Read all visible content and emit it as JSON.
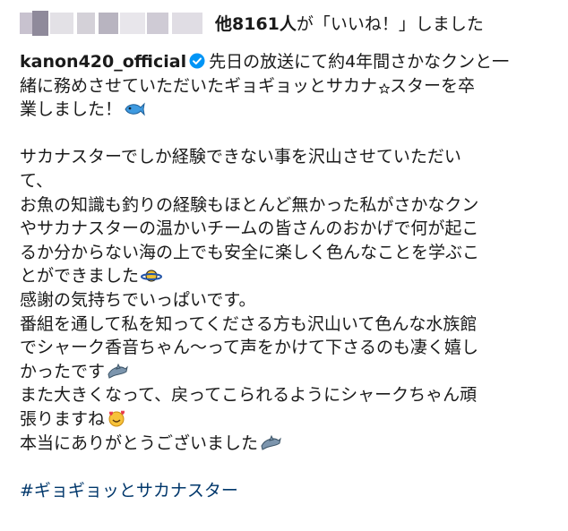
{
  "likes": {
    "count_label": "他8161人",
    "suffix": "が「いいね！」しました"
  },
  "post": {
    "username": "kanon420_official",
    "lines": [
      "先日の放送にて約4年間さかなクンと一",
      "緒に務めさせていただいたギョギョッとサカナ",
      "スターを卒",
      "業しました！",
      "サカナスターでしか経験できない事を沢山させていただい",
      "て、",
      "お魚の知識も釣りの経験もほとんど無かった私がさかなクン",
      "やサカナスターの温かいチームの皆さんのおかげで何が起こ",
      "るか分からない海の上でも安全に楽しく色んなことを学ぶこ",
      "とができました",
      "感謝の気持ちでいっぱいです。",
      "番組を通して私を知ってくださる方も沢山いて色んな水族館",
      "でシャーク香音ちゃん〜って声をかけて下さるのも凄く嬉し",
      "かったです",
      "また大きくなって、戻ってこられるようにシャークちゃん頑",
      "張りますね",
      "本当にありがとうございました"
    ],
    "hashtag": "#ギョギョッとサカナスター"
  },
  "icons": {
    "verified": "verified-badge-icon",
    "star": "star-icon",
    "fish": "fish-emoji-icon",
    "saturn": "ringed-planet-emoji-icon",
    "dolphin": "dolphin-emoji-icon",
    "smile": "smiling-face-with-hearts-emoji-icon"
  },
  "colors": {
    "verified": "#0095f6",
    "hashtag": "#00376b",
    "text": "#1a1a1a"
  }
}
